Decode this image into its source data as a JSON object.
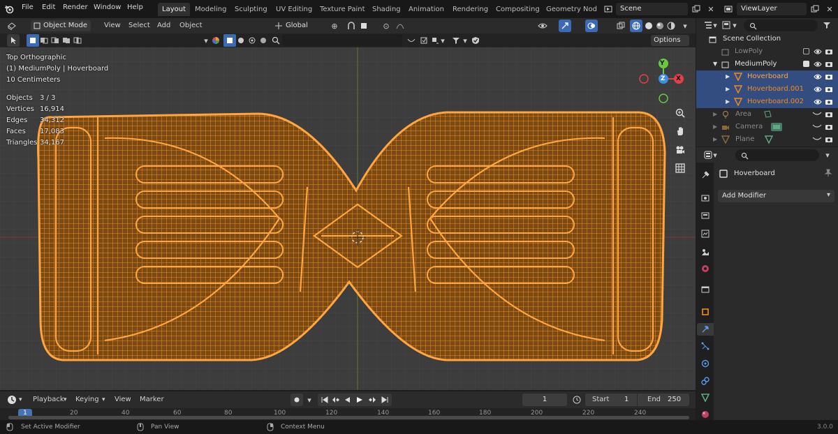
{
  "menu": [
    "File",
    "Edit",
    "Render",
    "Window",
    "Help"
  ],
  "workspaces": [
    {
      "label": "Layout",
      "active": true
    },
    {
      "label": "Modeling"
    },
    {
      "label": "Sculpting"
    },
    {
      "label": "UV Editing"
    },
    {
      "label": "Texture Paint"
    },
    {
      "label": "Shading"
    },
    {
      "label": "Animation"
    },
    {
      "label": "Rendering"
    },
    {
      "label": "Compositing"
    },
    {
      "label": "Geometry Nod"
    }
  ],
  "scene": "Scene",
  "view_layer": "ViewLayer",
  "header": {
    "mode": "Object Mode",
    "view": "View",
    "select": "Select",
    "add": "Add",
    "object": "Object",
    "orientation": "Global",
    "options": "Options"
  },
  "overlay": {
    "view_name": "Top Orthographic",
    "object_line": "(1) MediumPoly | Hoverboard",
    "scale": "10 Centimeters",
    "stats": [
      {
        "label": "Objects",
        "value": "3 / 3"
      },
      {
        "label": "Vertices",
        "value": "16,914"
      },
      {
        "label": "Edges",
        "value": "34,312"
      },
      {
        "label": "Faces",
        "value": "17,083"
      },
      {
        "label": "Triangles",
        "value": "34,167"
      }
    ],
    "gizmo": {
      "x": "X",
      "y": "Y",
      "z": "Z"
    }
  },
  "outliner": {
    "rows": [
      {
        "label": "Scene Collection",
        "indent": 0,
        "dim": false,
        "sel": false
      },
      {
        "label": "LowPoly",
        "indent": 1,
        "dim": true,
        "sel": false
      },
      {
        "label": "MediumPoly",
        "indent": 1,
        "dim": false,
        "sel": false
      },
      {
        "label": "Hoverboard",
        "indent": 2,
        "dim": false,
        "sel": true
      },
      {
        "label": "Hoverboard.001",
        "indent": 2,
        "dim": false,
        "sel": true
      },
      {
        "label": "Hoverboard.002",
        "indent": 2,
        "dim": false,
        "sel": true
      },
      {
        "label": "Area",
        "indent": 2,
        "dim": true,
        "sel": false
      },
      {
        "label": "Camera",
        "indent": 2,
        "dim": true,
        "sel": false
      },
      {
        "label": "Plane",
        "indent": 2,
        "dim": true,
        "sel": false
      }
    ]
  },
  "properties": {
    "object_name": "Hoverboard",
    "add_modifier": "Add Modifier"
  },
  "timeline": {
    "playback": "Playback",
    "keying": "Keying",
    "view": "View",
    "marker": "Marker",
    "current_frame": "1",
    "start_label": "Start",
    "start": "1",
    "end_label": "End",
    "end": "250",
    "ruler": [
      "1",
      "20",
      "40",
      "60",
      "80",
      "100",
      "120",
      "140",
      "160",
      "180",
      "200",
      "220",
      "240"
    ]
  },
  "status": {
    "left": "Set Active Modifier",
    "middle": "Pan View",
    "right": "Context Menu",
    "version": "3.0.0"
  },
  "colors": {
    "wire": "#f08c1e",
    "selected_row": "#334d80",
    "axis_x": "#e0404a",
    "axis_y": "#6ac840",
    "axis_z": "#3d8ee8"
  }
}
